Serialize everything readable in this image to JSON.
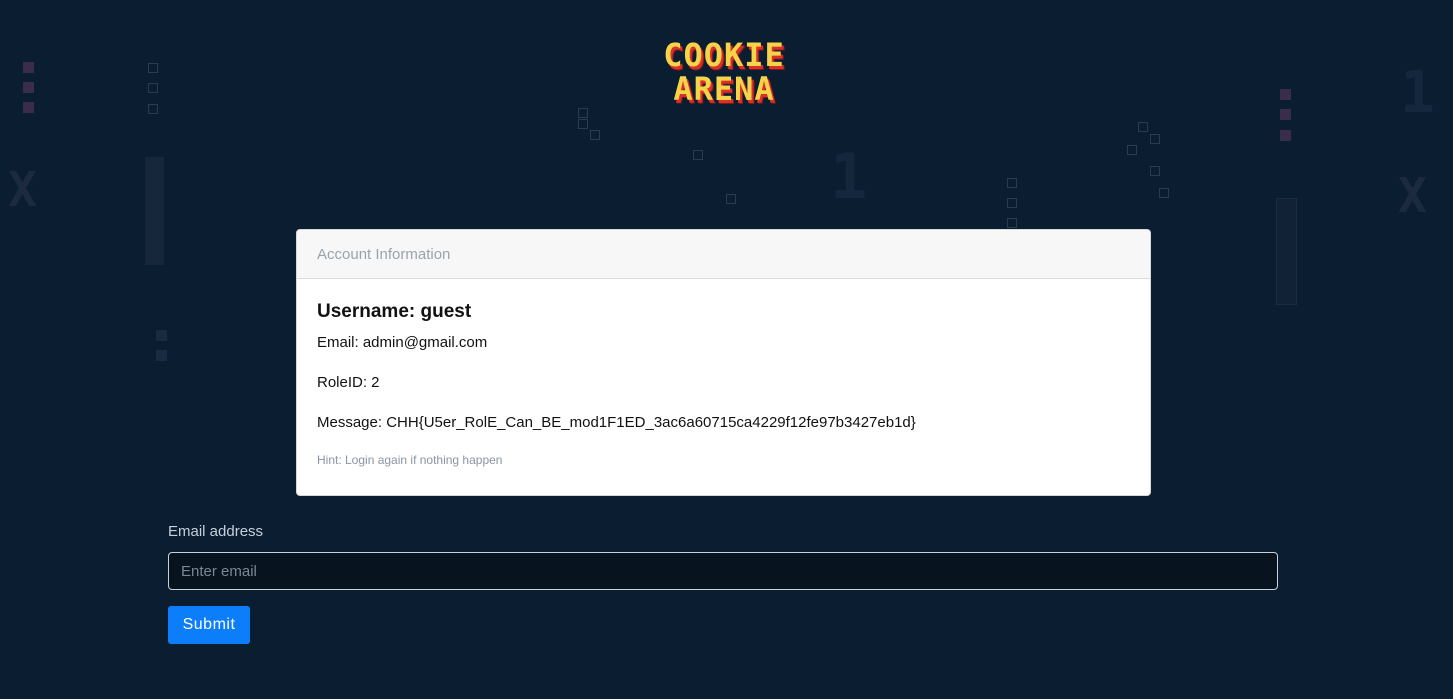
{
  "logo": {
    "line1": "COOKIE",
    "line2": "ARENA"
  },
  "card": {
    "header": "Account Information",
    "username": "Username: guest",
    "email": "Email: admin@gmail.com",
    "role": "RoleID: 2",
    "message": "Message: CHH{U5er_RolE_Can_BE_mod1F1ED_3ac6a60715ca4229f12fe97b3427eb1d}",
    "hint": "Hint: Login again if nothing happen"
  },
  "form": {
    "email_label": "Email address",
    "email_placeholder": "Enter email",
    "email_value": "",
    "submit_label": "Submit"
  },
  "colors": {
    "background": "#0b1d31",
    "logo_yellow": "#f6d44a",
    "logo_red": "#d9302a",
    "submit_blue": "#0d7ef9"
  },
  "decorations": {
    "left_glyph": "X",
    "right_glyph": "X",
    "digit_glyph": "1"
  }
}
